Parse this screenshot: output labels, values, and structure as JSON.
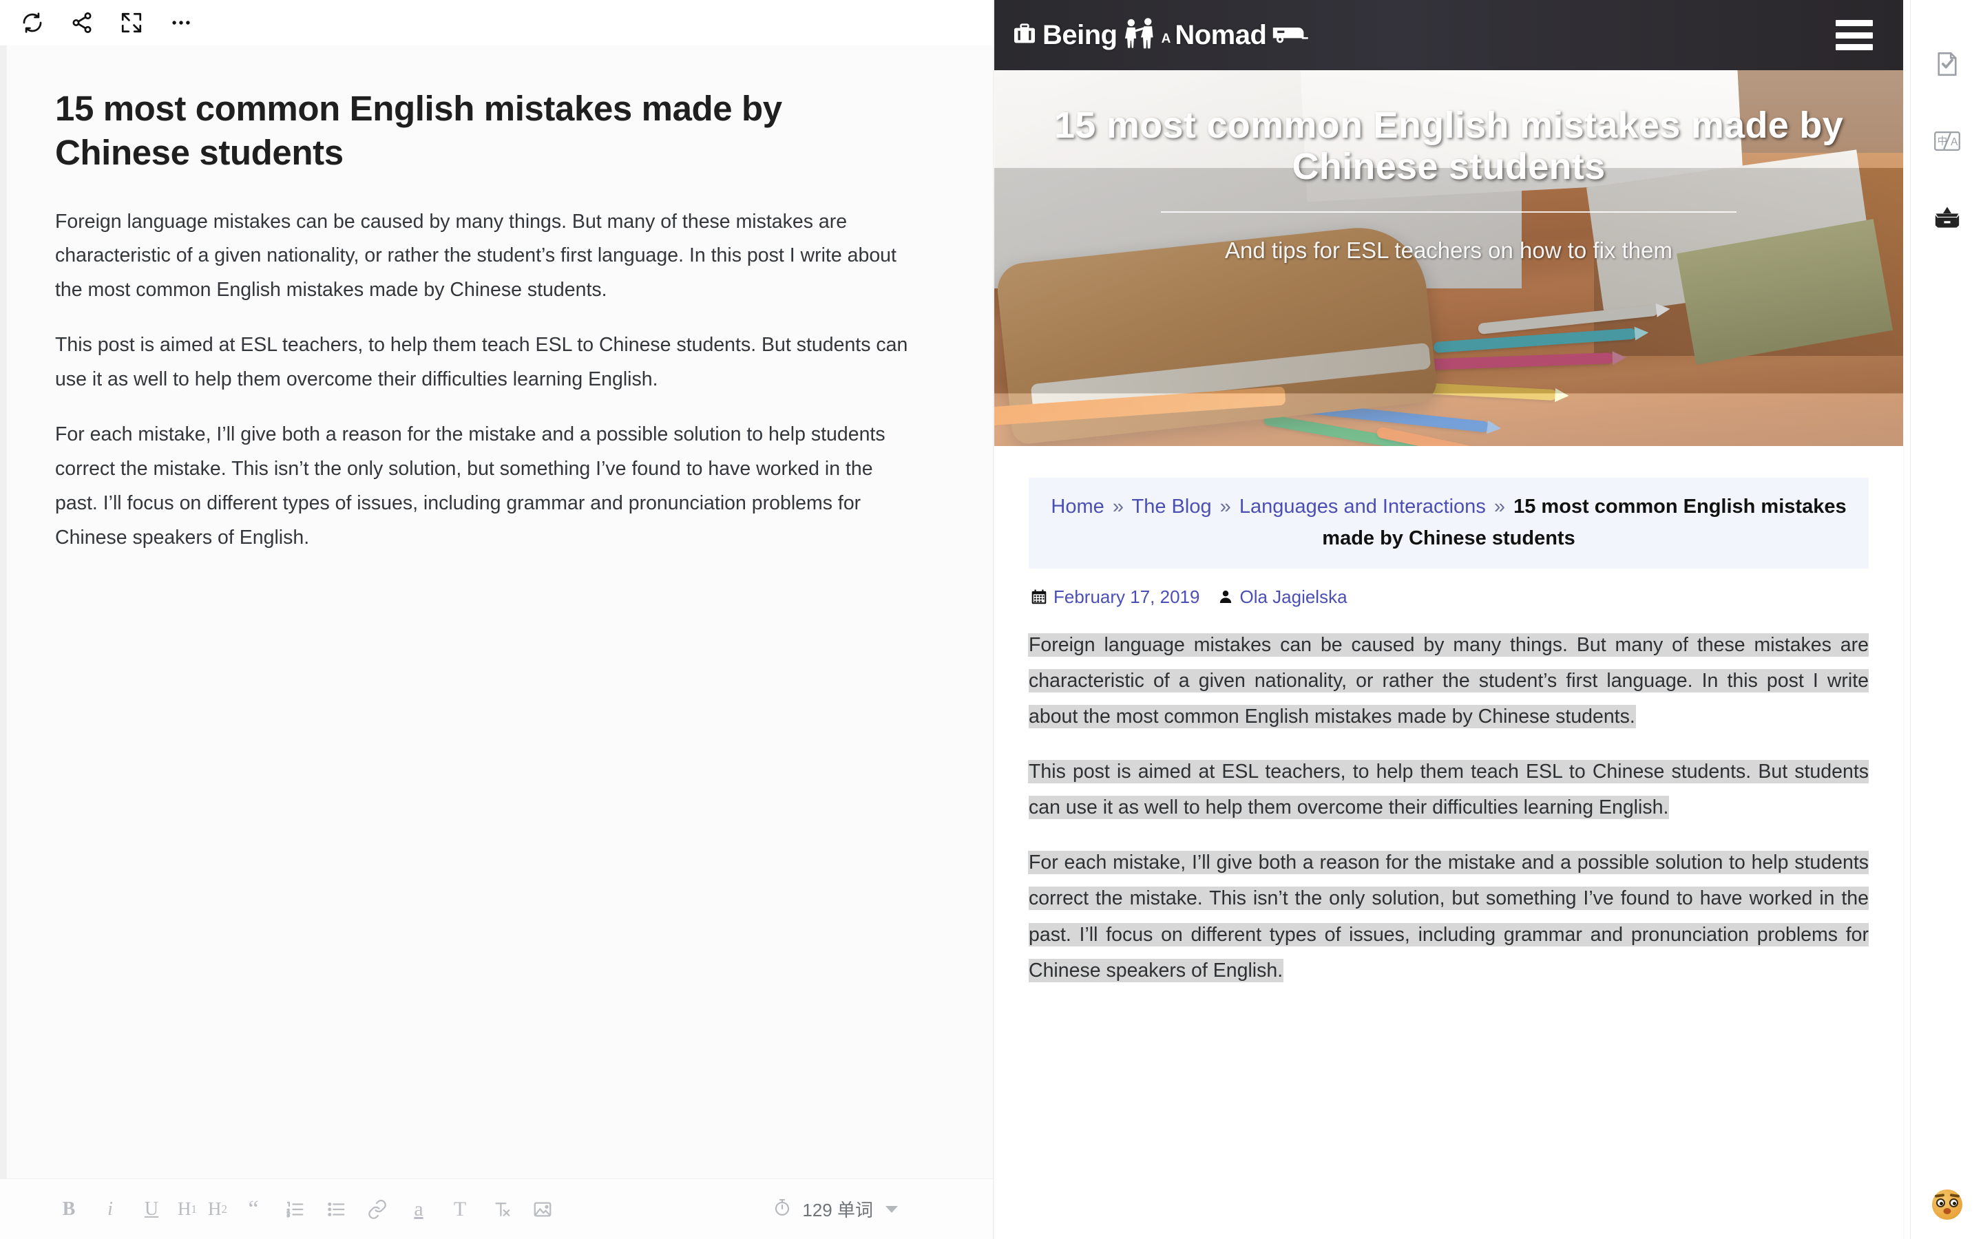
{
  "editor": {
    "toolbar_top": [
      {
        "name": "refresh-icon",
        "label": "Refresh"
      },
      {
        "name": "share-icon",
        "label": "Share"
      },
      {
        "name": "fullscreen-icon",
        "label": "Fullscreen"
      },
      {
        "name": "more-icon",
        "label": "More"
      }
    ],
    "document": {
      "title": "15 most common English mistakes made by Chinese students",
      "paragraphs": [
        "Foreign language mistakes can be caused by many things. But many of these mistakes are characteristic of a given nationality, or rather the student’s first language. In this post I write about the most common English mistakes made by Chinese students.",
        "This post is aimed at ESL teachers, to help them teach ESL to Chinese students. But students can use it as well to help them overcome their difficulties learning English.",
        "For each mistake, I’ll give both a reason for the mistake and a possible solution to help students correct the mistake. This isn’t the only solution, but something I’ve found to have worked in the past. I’ll focus on different types of issues, including grammar and pronunciation problems for Chinese speakers of English."
      ]
    },
    "toolbar_bottom": {
      "bold": "B",
      "italic": "i",
      "underline": "U",
      "h1": "H",
      "h1_sub": "1",
      "h2": "H",
      "h2_sub": "2",
      "blockquote": "“",
      "ordered_list": "ordered-list-icon",
      "unordered_list": "unordered-list-icon",
      "link": "link-icon",
      "highlight": "a",
      "text_color": "T",
      "clear_format": "clear-format-icon",
      "image": "image-icon",
      "timer": "timer-icon",
      "word_count": "129 单词"
    }
  },
  "preview": {
    "site": {
      "brand_left": "Being",
      "brand_a": "A",
      "brand_right": "Nomad",
      "menu": "hamburger-menu"
    },
    "hero": {
      "title": "15 most common English mistakes made by Chinese students",
      "subtitle": "And tips for ESL teachers on how to fix them"
    },
    "breadcrumb": {
      "items": [
        {
          "label": "Home",
          "link": true
        },
        {
          "label": "The Blog",
          "link": true
        },
        {
          "label": "Languages and Interactions",
          "link": true
        },
        {
          "label": "15 most common English mistakes made by Chinese students",
          "link": false
        }
      ],
      "separator": "»"
    },
    "meta": {
      "date": "February 17, 2019",
      "author": "Ola Jagielska",
      "date_icon": "calendar-icon",
      "author_icon": "user-icon"
    },
    "paragraphs": [
      "Foreign language mistakes can be caused by many things. But many of these mistakes are characteristic of a given nationality, or rather the student’s first language. In this post I write about the most common English mistakes made by Chinese students.",
      "This post is aimed at ESL teachers, to help them teach ESL to Chinese students. But students can use it as well to help them overcome their difficulties learning English.",
      "For each mistake, I’ll give both a reason for the mistake and a possible solution to help students correct the mistake. This isn’t the only solution, but something I’ve found to have worked in the past. I’ll focus on different types of issues, including grammar and pronunciation problems for Chinese speakers of English."
    ]
  },
  "rail": {
    "items": [
      {
        "name": "document-check-icon",
        "label": "Proofread"
      },
      {
        "name": "translate-icon",
        "label": "Translate"
      },
      {
        "name": "archive-box-icon",
        "label": "Archive"
      }
    ],
    "emoji": {
      "name": "emoji-face-icon",
      "label": "Emoji"
    }
  },
  "colors": {
    "accent_link": "#4b4fb5",
    "selection": "#d7d7d7",
    "breadcrumb_bg": "#f2f5fb",
    "header_bg": "#2b2a2e"
  }
}
